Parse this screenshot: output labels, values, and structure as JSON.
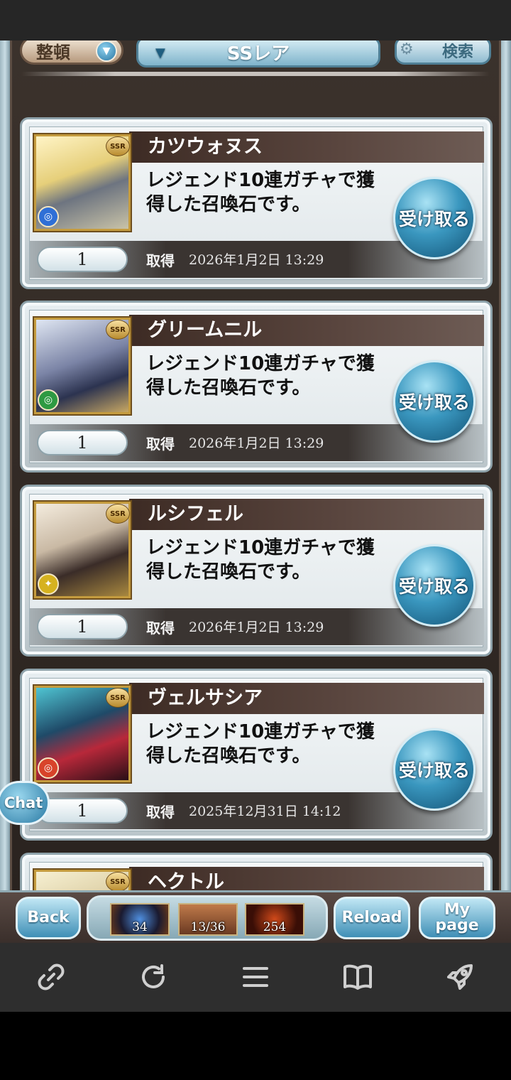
{
  "filter": {
    "sort_label": "整頓",
    "rarity_label": "SSレア",
    "search_label": "検索"
  },
  "cards": [
    {
      "name": "カツウォヌス",
      "description": "レジェンド10連ガチャで獲得した召喚石です。",
      "rarity": "SSR",
      "element": "water",
      "quantity": "1",
      "acquired_label": "取得",
      "acquired_date": "2026年1月2日 13:29",
      "receive_label": "受け取る"
    },
    {
      "name": "グリームニル",
      "description": "レジェンド10連ガチャで獲得した召喚石です。",
      "rarity": "SSR",
      "element": "wind",
      "quantity": "1",
      "acquired_label": "取得",
      "acquired_date": "2026年1月2日 13:29",
      "receive_label": "受け取る"
    },
    {
      "name": "ルシフェル",
      "description": "レジェンド10連ガチャで獲得した召喚石です。",
      "rarity": "SSR",
      "element": "light",
      "quantity": "1",
      "acquired_label": "取得",
      "acquired_date": "2026年1月2日 13:29",
      "receive_label": "受け取る"
    },
    {
      "name": "ヴェルサシア",
      "description": "レジェンド10連ガチャで獲得した召喚石です。",
      "rarity": "SSR",
      "element": "fire",
      "quantity": "1",
      "acquired_label": "取得",
      "acquired_date": "2025年12月31日 14:12",
      "receive_label": "受け取る"
    },
    {
      "name": "ヘクトル",
      "rarity": "SSR"
    }
  ],
  "chat_label": "Chat",
  "game_nav": {
    "back_label": "Back",
    "reload_label": "Reload",
    "mypage_label": "My page",
    "items": [
      "34",
      "13/36",
      "254"
    ]
  },
  "browser_nav": {
    "icons": [
      "link-icon",
      "refresh-icon",
      "menu-icon",
      "book-icon",
      "rocket-icon"
    ]
  }
}
